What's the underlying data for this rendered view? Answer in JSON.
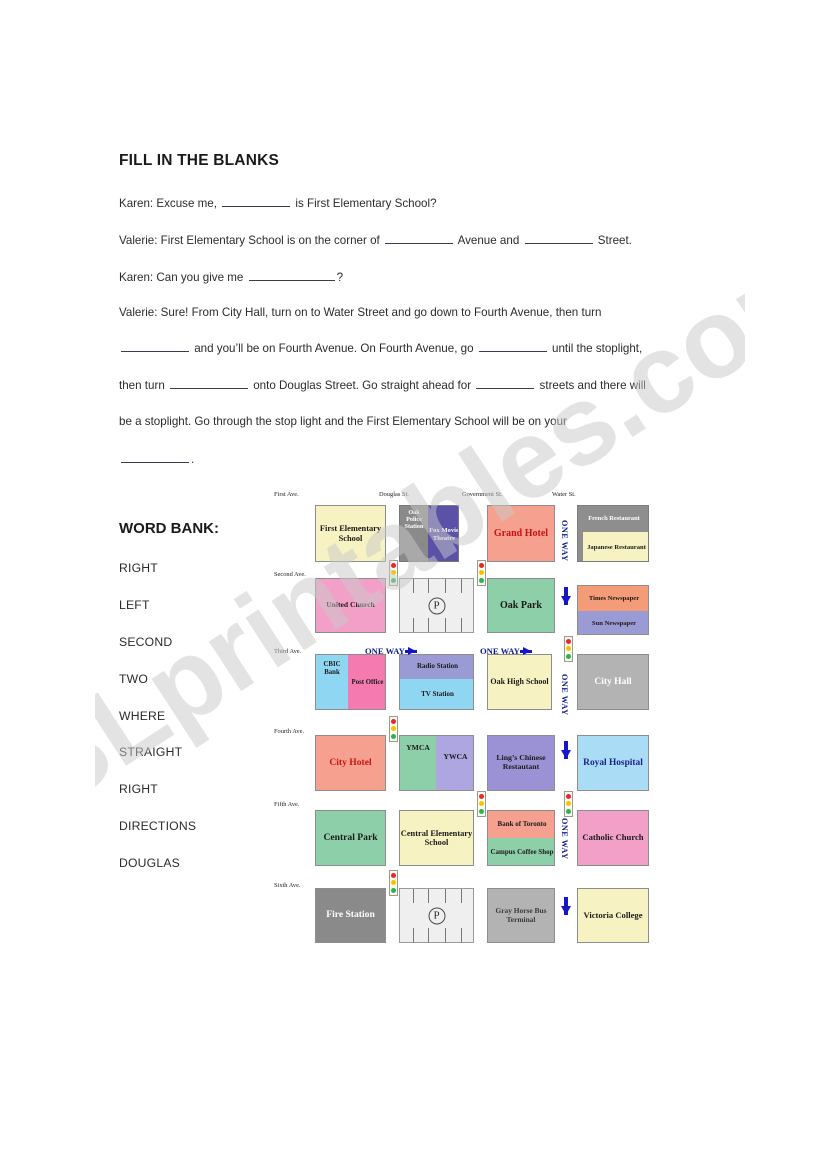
{
  "worksheet": {
    "title": "FILL IN THE BLANKS",
    "lines": {
      "l1a": "Karen: Excuse me,",
      "l1b": "is First Elementary School?",
      "l2a": "Valerie: First Elementary School is on the corner of",
      "l2b": "Avenue and",
      "l2c": "Street.",
      "l3a": "Karen: Can you give me",
      "l3b": "?",
      "l4a": "Valerie: Sure! From City Hall, turn on to Water Street and go down to Fourth Avenue, then turn",
      "l4b": "and you’ll be on Fourth Avenue. On Fourth Avenue, go",
      "l4c": "until the stoplight,",
      "l4d": "then turn",
      "l4e": "onto Douglas Street. Go straight ahead for",
      "l4f": "streets and there will",
      "l4g": "be a stoplight. Go through the stop light and the First Elementary School will be on your",
      "l4h": "."
    }
  },
  "word_bank": {
    "title": "WORD BANK:",
    "words": [
      "RIGHT",
      "LEFT",
      "SECOND",
      "TWO",
      "WHERE",
      "STRAIGHT",
      "RIGHT",
      "DIRECTIONS",
      "DOUGLAS"
    ]
  },
  "map": {
    "streets_vertical": [
      "Douglas St.",
      "Government St.",
      "Water St."
    ],
    "streets_horizontal": [
      "First Ave.",
      "Second Ave.",
      "Third Ave.",
      "Fourth Ave.",
      "Fifth Ave.",
      "Sixth Ave."
    ],
    "one_way_labels": {
      "horizontal_1": "ONE WAY",
      "horizontal_2": "ONE WAY",
      "vertical_1": "ONE WAY",
      "vertical_2": "ONE WAY",
      "vertical_3": "ONE WAY"
    },
    "parking_symbol": "P",
    "buildings": [
      {
        "id": "first-elementary-school",
        "label": "First Elementary School",
        "fill": "#f7f2c2",
        "text": "#1a1a1a"
      },
      {
        "id": "oak-police-station",
        "label": "Oak Police Station",
        "fill": "#8a8a8a",
        "text": "#ffffff"
      },
      {
        "id": "fox-movie-theatre",
        "label": "Fox Movie Theatre",
        "fill": "#5b52a8",
        "text": "#ffffff"
      },
      {
        "id": "grand-hotel",
        "label": "Grand Hotel",
        "fill": "#f6a190",
        "text": "#cc1111"
      },
      {
        "id": "french-restaurant",
        "label": "French Restaurant",
        "fill": "#8e8e8e",
        "text": "#ffffff"
      },
      {
        "id": "japanese-restaurant",
        "label": "Japanese Restaurant",
        "fill": "#f7f2c2",
        "text": "#1a1a1a"
      },
      {
        "id": "united-church",
        "label": "United Church",
        "fill": "#f2a0c8",
        "text": "#1a1a1a"
      },
      {
        "id": "oak-park",
        "label": "Oak Park",
        "fill": "#8ccfa8",
        "text": "#1a1a1a"
      },
      {
        "id": "times-newspaper",
        "label": "Times Newspaper",
        "fill": "#f49b77",
        "text": "#1a1a1a"
      },
      {
        "id": "sun-newspaper",
        "label": "Sun Newspaper",
        "fill": "#9a9ad4",
        "text": "#1a1a1a"
      },
      {
        "id": "cbic-bank",
        "label": "CBIC Bank",
        "fill": "#8fd6f2",
        "text": "#1a1a1a"
      },
      {
        "id": "post-office",
        "label": "Post Office",
        "fill": "#f47ab0",
        "text": "#1a1a1a"
      },
      {
        "id": "radio-station",
        "label": "Radio Station",
        "fill": "#9a9ad4",
        "text": "#1a1a1a"
      },
      {
        "id": "tv-station",
        "label": "TV Station",
        "fill": "#8fd6f2",
        "text": "#1a1a1a"
      },
      {
        "id": "oak-high-school",
        "label": "Oak High School",
        "fill": "#f7f2c2",
        "text": "#1a1a1a"
      },
      {
        "id": "city-hall",
        "label": "City Hall",
        "fill": "#b3b3b3",
        "text": "#ffffff"
      },
      {
        "id": "city-hotel",
        "label": "City Hotel",
        "fill": "#f6a190",
        "text": "#cc1111"
      },
      {
        "id": "ymca",
        "label": "YMCA",
        "fill": "#8ccfa8",
        "text": "#1a1a1a"
      },
      {
        "id": "ywca",
        "label": "YWCA",
        "fill": "#ada6e0",
        "text": "#1a1a1a"
      },
      {
        "id": "lings-chinese-restaurant",
        "label": "Ling’s Chinese Restautant",
        "fill": "#9a92d4",
        "text": "#1a1a1a"
      },
      {
        "id": "royal-hospital",
        "label": "Royal Hospital",
        "fill": "#aadcf5",
        "text": "#1a1f8c"
      },
      {
        "id": "central-park",
        "label": "Central Park",
        "fill": "#8ccfa8",
        "text": "#1a1a1a"
      },
      {
        "id": "central-elementary-school",
        "label": "Central Elementary School",
        "fill": "#f7f2c2",
        "text": "#1a1a1a"
      },
      {
        "id": "bank-of-toronto",
        "label": "Bank of Toronto",
        "fill": "#f6a190",
        "text": "#1a1a1a"
      },
      {
        "id": "campus-coffee-shop",
        "label": "Campus Coffee Shop",
        "fill": "#8ccfa8",
        "text": "#1a1a1a"
      },
      {
        "id": "catholic-church",
        "label": "Catholic Church",
        "fill": "#f2a0c8",
        "text": "#1a1a1a"
      },
      {
        "id": "fire-station",
        "label": "Fire Station",
        "fill": "#8a8a8a",
        "text": "#ffffff"
      },
      {
        "id": "gray-horse-bus-terminal",
        "label": "Gray Horse Bus Terminal",
        "fill": "#b3b3b3",
        "text": "#3a3a3a"
      },
      {
        "id": "victoria-college",
        "label": "Victoria College",
        "fill": "#f7f2c2",
        "text": "#1a1a1a"
      }
    ]
  },
  "watermark": {
    "text": "ESLprintables.com"
  }
}
